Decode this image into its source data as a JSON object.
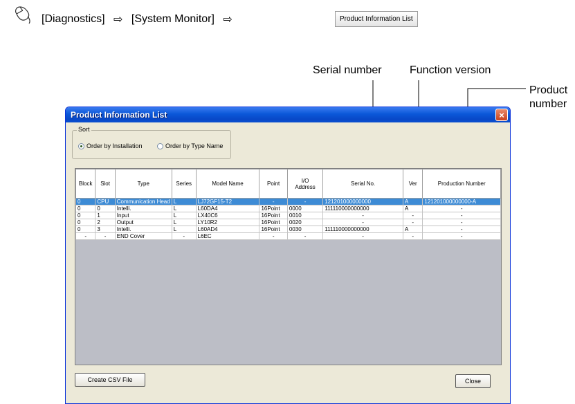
{
  "path": {
    "item1": "[Diagnostics]",
    "item2": "[System Monitor]",
    "arrow": "⇨",
    "button_label": "Product Information List"
  },
  "callouts": {
    "serial": "Serial number",
    "function": "Function version",
    "product_line1": "Product",
    "product_line2": "number"
  },
  "dialog": {
    "title": "Product Information List",
    "close_glyph": "×",
    "sort": {
      "legend": "Sort",
      "option1": "Order by Installation",
      "option2": "Order by Type Name",
      "selected": "Order by Installation"
    },
    "columns": [
      "Block",
      "Slot",
      "Type",
      "Series",
      "Model Name",
      "Point",
      "I/O\nAddress",
      "Serial No.",
      "Ver",
      "Production Number"
    ],
    "rows": [
      [
        "0",
        "CPU",
        "Communication Head",
        "L",
        "LJ72GF15-T2",
        "-",
        "-",
        "121201000000000",
        "A",
        "121201000000000-A"
      ],
      [
        "0",
        "0",
        "Intelli.",
        "L",
        "L60DA4",
        "16Point",
        "0000",
        "111110000000000",
        "A",
        "-"
      ],
      [
        "0",
        "1",
        "Input",
        "L",
        "LX40C6",
        "16Point",
        "0010",
        "-",
        "-",
        "-"
      ],
      [
        "0",
        "2",
        "Output",
        "L",
        "LY10R2",
        "16Point",
        "0020",
        "-",
        "-",
        "-"
      ],
      [
        "0",
        "3",
        "Intelli.",
        "L",
        "L60AD4",
        "16Point",
        "0030",
        "111110000000000",
        "A",
        "-"
      ],
      [
        "-",
        "-",
        "END Cover",
        "-",
        "L6EC",
        "-",
        "-",
        "-",
        "-",
        "-"
      ]
    ],
    "create_csv_label": "Create CSV File",
    "close_label": "Close"
  },
  "colors": {
    "titlebar": "#0a57d8",
    "selected_row": "#3d8bd5",
    "grid_bg": "#bcbec6"
  }
}
